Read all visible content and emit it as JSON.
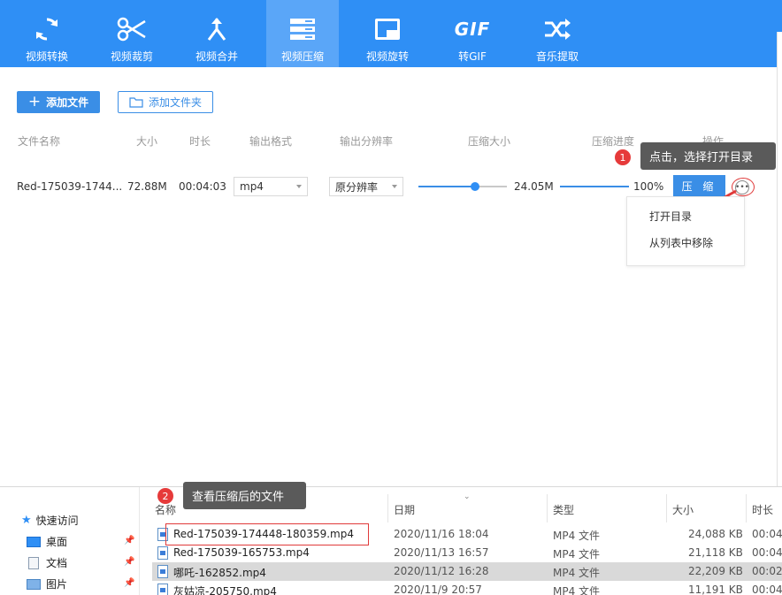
{
  "toolbar": {
    "items": [
      {
        "label": "视频转换",
        "icon": "refresh-icon"
      },
      {
        "label": "视频裁剪",
        "icon": "scissors-icon"
      },
      {
        "label": "视频合并",
        "icon": "merge-icon"
      },
      {
        "label": "视频压缩",
        "icon": "compress-icon"
      },
      {
        "label": "视频旋转",
        "icon": "rotate-icon"
      },
      {
        "label": "转GIF",
        "icon": "gif-icon",
        "icon_text": "GIF"
      },
      {
        "label": "音乐提取",
        "icon": "shuffle-icon"
      }
    ],
    "active_index": 3,
    "color": "#2f8ff5"
  },
  "actions": {
    "add_file": "添加文件",
    "add_folder": "添加文件夹"
  },
  "table": {
    "headers": [
      "文件名称",
      "大小",
      "时长",
      "输出格式",
      "输出分辨率",
      "压缩大小",
      "压缩进度",
      "操作"
    ],
    "row": {
      "name": "Red-175039-1744...",
      "size": "72.88M",
      "duration": "00:04:03",
      "format": "mp4",
      "resolution": "原分辨率",
      "compressed_size": "24.05M",
      "slider_level": 0.64,
      "progress": "100%",
      "progress_value": 1.0,
      "compress_button": "压 缩"
    }
  },
  "row_menu": {
    "items": [
      "打开目录",
      "从列表中移除"
    ]
  },
  "callouts": {
    "one": {
      "badge": "1",
      "text": "点击，选择打开目录"
    },
    "two": {
      "badge": "2",
      "text": "查看压缩后的文件"
    }
  },
  "explorer": {
    "nav": [
      {
        "label": "快速访问",
        "icon": "star-icon"
      },
      {
        "label": "桌面",
        "icon": "desktop-icon"
      },
      {
        "label": "文档",
        "icon": "documents-icon"
      },
      {
        "label": "图片",
        "icon": "pictures-icon"
      }
    ],
    "columns": [
      "名称",
      "日期",
      "类型",
      "大小",
      "时长"
    ],
    "files": [
      {
        "name": "Red-175039-174448-180359.mp4",
        "date": "2020/11/16 18:04",
        "type": "MP4 文件",
        "size": "24,088 KB",
        "duration": "00:04"
      },
      {
        "name": "Red-175039-165753.mp4",
        "date": "2020/11/13 16:57",
        "type": "MP4 文件",
        "size": "21,118 KB",
        "duration": "00:04"
      },
      {
        "name": "哪吒-162852.mp4",
        "date": "2020/11/12 16:28",
        "type": "MP4 文件",
        "size": "22,209 KB",
        "duration": "00:02"
      },
      {
        "name": "灰姑凉-205750.mp4",
        "date": "2020/11/9 20:57",
        "type": "MP4 文件",
        "size": "11,191 KB",
        "duration": "00:04"
      }
    ],
    "selected_index": 2
  }
}
